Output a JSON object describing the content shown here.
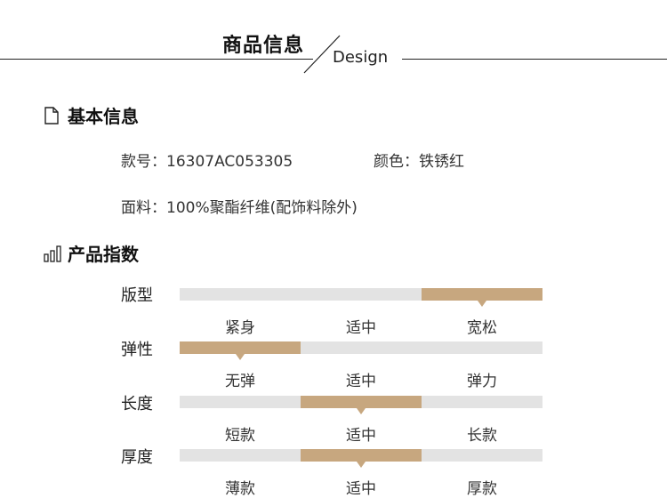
{
  "header": {
    "title": "商品信息",
    "subtitle": "Design"
  },
  "basic": {
    "title": "基本信息",
    "style_no": "款号：16307AC053305",
    "color": "颜色：铁锈红",
    "material": "面料：100%聚酯纤维(配饰料除外)"
  },
  "index": {
    "title": "产品指数",
    "accent_color": "#c7a77f",
    "track_color": "#e3e3e3",
    "rows": [
      {
        "label": "版型",
        "options": [
          "紧身",
          "适中",
          "宽松"
        ],
        "selected_index": 2
      },
      {
        "label": "弹性",
        "options": [
          "无弹",
          "适中",
          "弹力"
        ],
        "selected_index": 0
      },
      {
        "label": "长度",
        "options": [
          "短款",
          "适中",
          "长款"
        ],
        "selected_index": 1
      },
      {
        "label": "厚度",
        "options": [
          "薄款",
          "适中",
          "厚款"
        ],
        "selected_index": 1
      }
    ]
  }
}
